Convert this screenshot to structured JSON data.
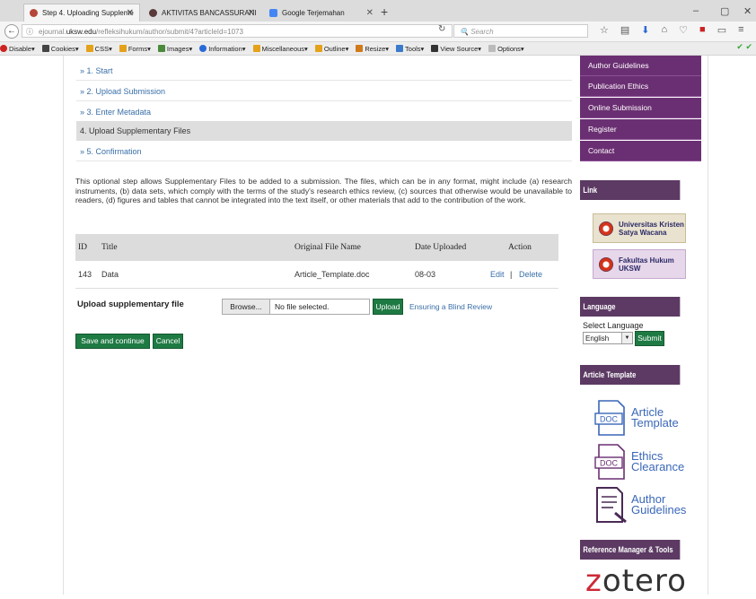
{
  "browser": {
    "tabs": [
      {
        "label": "Step 4. Uploading Suppleme",
        "icon": "site-favicon"
      },
      {
        "label": "AKTIVITAS BANCASSURANI",
        "icon": "site-favicon"
      },
      {
        "label": "Google Terjemahan",
        "icon": "translate-favicon"
      }
    ],
    "url_prefix": "ejournal.",
    "url_domain": "uksw.edu",
    "url_path": "/refleksihukum/author/submit/4?articleId=1073",
    "search_placeholder": "Search",
    "window_controls": [
      "–",
      "▢",
      "✕"
    ]
  },
  "toolbar": {
    "items": [
      "Disable▾",
      "Cookies▾",
      "CSS▾",
      "Forms▾",
      "Images▾",
      "Information▾",
      "Miscellaneous▾",
      "Outline▾",
      "Resize▾",
      "Tools▾",
      "View Source▾",
      "Options▾"
    ],
    "status": "✔ ✔"
  },
  "steps": [
    {
      "label": "» 1. Start",
      "current": false
    },
    {
      "label": "» 2. Upload Submission",
      "current": false
    },
    {
      "label": "» 3. Enter Metadata",
      "current": false
    },
    {
      "label": "4. Upload Supplementary Files",
      "current": true
    },
    {
      "label": "» 5. Confirmation",
      "current": false
    }
  ],
  "description": "This optional step allows Supplementary Files to be added to a submission. The files, which can be in any format, might include (a) research instruments, (b) data sets, which comply with the terms of the study's research ethics review, (c) sources that otherwise would be unavailable to readers, (d) figures and tables that cannot be integrated into the text itself, or other materials that add to the contribution of the work.",
  "table": {
    "headers": [
      "ID",
      "Title",
      "Original File Name",
      "Date Uploaded",
      "Action"
    ],
    "rows": [
      {
        "id": "143",
        "title": "Data",
        "file": "Article_Template.doc",
        "date": "08-03",
        "edit": "Edit",
        "sep": "|",
        "delete": "Delete"
      }
    ]
  },
  "upload": {
    "label": "Upload supplementary file",
    "browse": "Browse...",
    "no_file": "No file selected.",
    "upload_button": "Upload",
    "blind_review_link": "Ensuring a Blind Review"
  },
  "actions": {
    "save": "Save and continue",
    "cancel": "Cancel"
  },
  "sidebar": {
    "menu": [
      "Author Guidelines",
      "Publication Ethics",
      "Online Submission",
      "Register",
      "Contact"
    ],
    "link_heading": "Link",
    "links": [
      {
        "line1": "Universitas Kristen",
        "line2": "Satya Wacana"
      },
      {
        "line1": "Fakultas Hukum",
        "line2": "UKSW"
      }
    ],
    "language_heading": "Language",
    "select_language": "Select Language",
    "language_value": "English",
    "submit": "Submit",
    "template_heading": "Article Template",
    "templates": [
      {
        "line1": "Article",
        "line2": "Template",
        "badge": "DOC"
      },
      {
        "line1": "Ethics",
        "line2": "Clearance",
        "badge": "DOC"
      },
      {
        "line1": "Author",
        "line2": "Guidelines",
        "badge": ""
      }
    ],
    "reference_heading": "Reference Manager & Tools",
    "zotero_z": "z",
    "zotero_rest": "otero"
  },
  "colors": {
    "purple": "#6a2f72",
    "green_button": "#1e7a43",
    "link": "#3a6fa8"
  }
}
